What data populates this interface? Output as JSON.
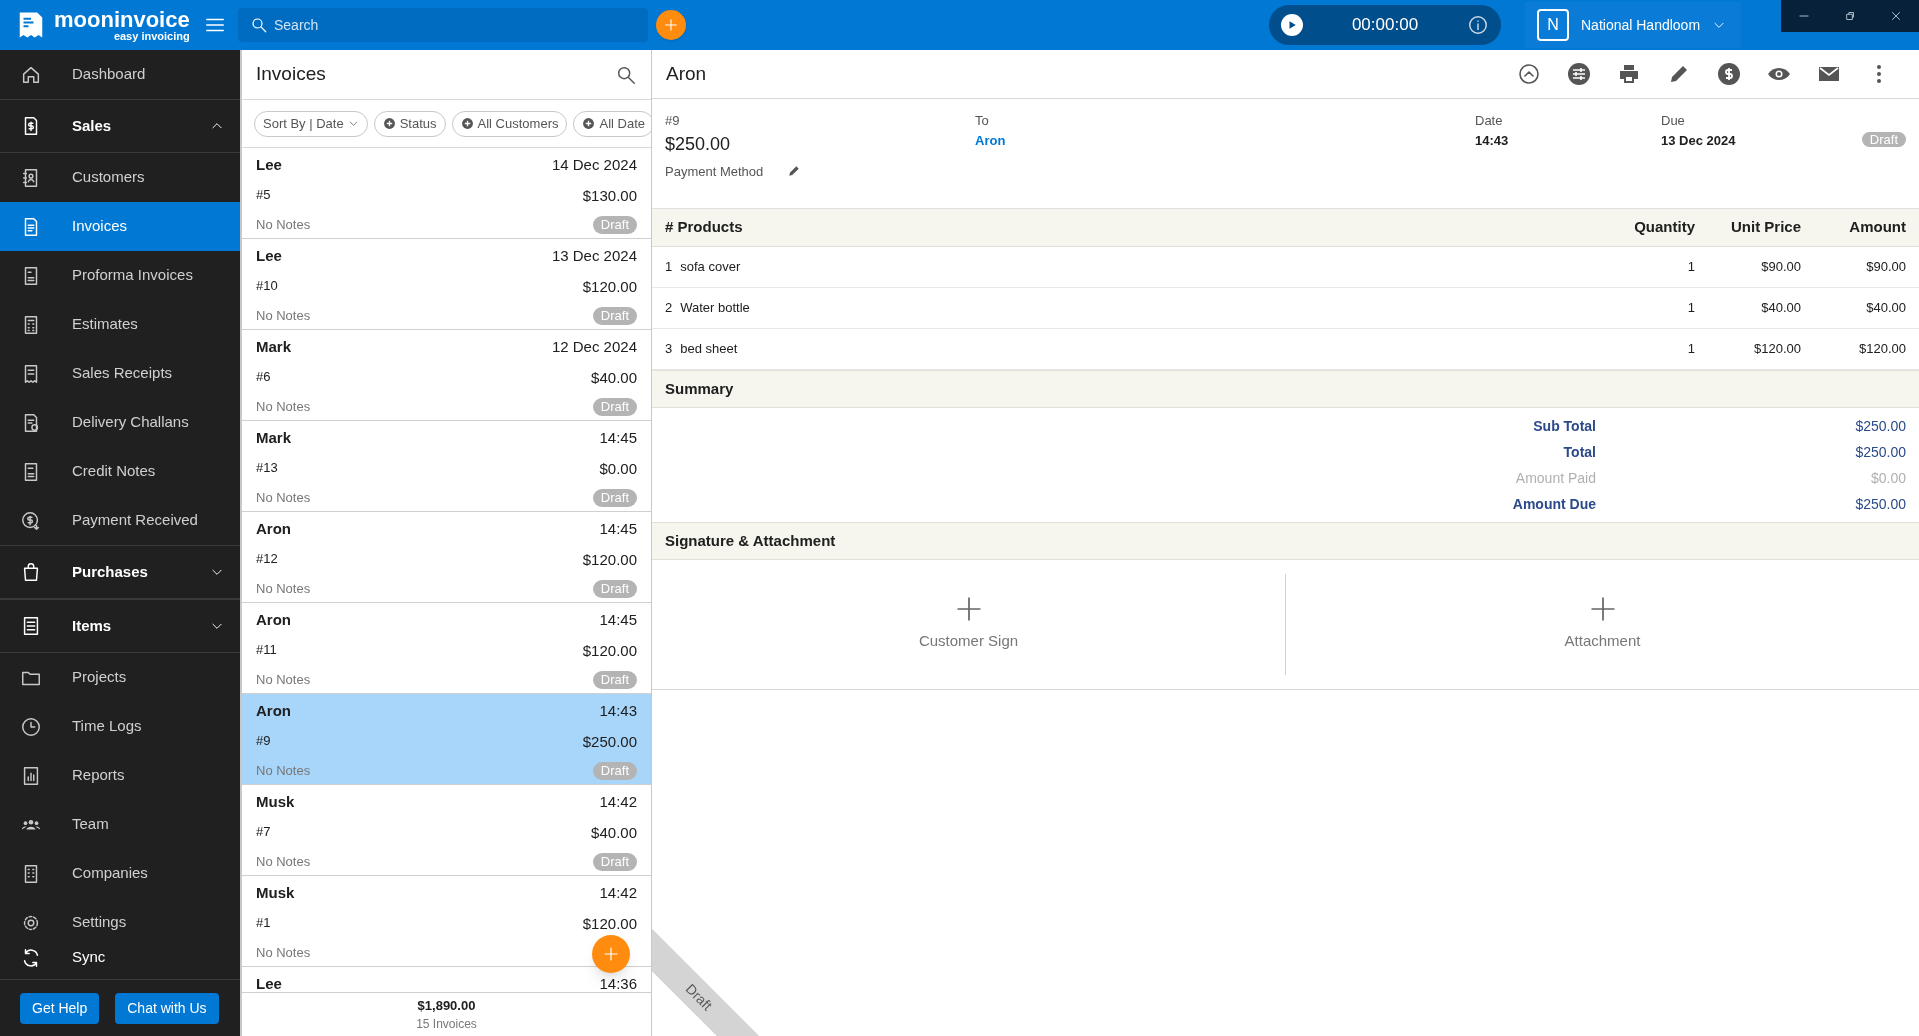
{
  "topbar": {
    "logo": "mooninvoice",
    "tagline": "easy invoicing",
    "search": {
      "placeholder": "Search"
    },
    "timer": "00:00:00",
    "company_initial": "N",
    "company": "National Handloom"
  },
  "sidebar": {
    "items": [
      {
        "kind": "item",
        "label": "Dashboard",
        "selected": false
      },
      {
        "kind": "section",
        "label": "Sales",
        "expanded": true
      },
      {
        "kind": "item",
        "label": "Customers",
        "selected": false
      },
      {
        "kind": "item",
        "label": "Invoices",
        "selected": true
      },
      {
        "kind": "item",
        "label": "Proforma Invoices",
        "selected": false
      },
      {
        "kind": "item",
        "label": "Estimates",
        "selected": false
      },
      {
        "kind": "item",
        "label": "Sales Receipts",
        "selected": false
      },
      {
        "kind": "item",
        "label": "Delivery Challans",
        "selected": false
      },
      {
        "kind": "item",
        "label": "Credit Notes",
        "selected": false
      },
      {
        "kind": "item",
        "label": "Payment Received",
        "selected": false
      },
      {
        "kind": "section",
        "label": "Purchases",
        "expanded": false
      },
      {
        "kind": "section",
        "label": "Items",
        "expanded": false
      },
      {
        "kind": "item",
        "label": "Projects",
        "selected": false
      },
      {
        "kind": "item",
        "label": "Time Logs",
        "selected": false
      },
      {
        "kind": "item",
        "label": "Reports",
        "selected": false
      },
      {
        "kind": "item",
        "label": "Team",
        "selected": false
      },
      {
        "kind": "item",
        "label": "Companies",
        "selected": false
      },
      {
        "kind": "item",
        "label": "Settings",
        "selected": false
      }
    ],
    "sync": "Sync",
    "buttons": [
      "Get Help",
      "Chat with Us"
    ]
  },
  "list": {
    "title": "Invoices",
    "filters": [
      "Sort By | Date",
      "Status",
      "All Customers",
      "All Date"
    ],
    "invoices": [
      {
        "customer": "Lee",
        "date": "14 Dec 2024",
        "number": "#5",
        "amount": "$130.00",
        "notes": "No Notes",
        "status": "Draft",
        "selected": false
      },
      {
        "customer": "Lee",
        "date": "13 Dec 2024",
        "number": "#10",
        "amount": "$120.00",
        "notes": "No Notes",
        "status": "Draft",
        "selected": false
      },
      {
        "customer": "Mark",
        "date": "12 Dec 2024",
        "number": "#6",
        "amount": "$40.00",
        "notes": "No Notes",
        "status": "Draft",
        "selected": false
      },
      {
        "customer": "Mark",
        "date": "14:45",
        "number": "#13",
        "amount": "$0.00",
        "notes": "No Notes",
        "status": "Draft",
        "selected": false
      },
      {
        "customer": "Aron",
        "date": "14:45",
        "number": "#12",
        "amount": "$120.00",
        "notes": "No Notes",
        "status": "Draft",
        "selected": false
      },
      {
        "customer": "Aron",
        "date": "14:45",
        "number": "#11",
        "amount": "$120.00",
        "notes": "No Notes",
        "status": "Draft",
        "selected": false
      },
      {
        "customer": "Aron",
        "date": "14:43",
        "number": "#9",
        "amount": "$250.00",
        "notes": "No Notes",
        "status": "Draft",
        "selected": true
      },
      {
        "customer": "Musk",
        "date": "14:42",
        "number": "#7",
        "amount": "$40.00",
        "notes": "No Notes",
        "status": "Draft",
        "selected": false
      },
      {
        "customer": "Musk",
        "date": "14:42",
        "number": "#1",
        "amount": "$120.00",
        "notes": "No Notes",
        "selected": false
      },
      {
        "customer": "Lee",
        "date": "14:36",
        "selected": false
      }
    ],
    "total": "$1,890.00",
    "count": "15 Invoices"
  },
  "detail": {
    "title": "Aron",
    "number": "#9",
    "amount": "$250.00",
    "payment_method": "Payment Method",
    "to_label": "To",
    "to": "Aron",
    "date_label": "Date",
    "date": "14:43",
    "due_label": "Due",
    "due": "13 Dec 2024",
    "status": "Draft",
    "products": {
      "columns": [
        "# Products",
        "Quantity",
        "Unit Price",
        "Amount"
      ],
      "rows": [
        {
          "index": "1",
          "name": "sofa cover",
          "quantity": "1",
          "unit_price": "$90.00",
          "amount": "$90.00"
        },
        {
          "index": "2",
          "name": "Water bottle",
          "quantity": "1",
          "unit_price": "$40.00",
          "amount": "$40.00"
        },
        {
          "index": "3",
          "name": "bed sheet",
          "quantity": "1",
          "unit_price": "$120.00",
          "amount": "$120.00"
        }
      ]
    },
    "summary": {
      "title": "Summary",
      "rows": [
        {
          "label": "Sub Total",
          "value": "$250.00",
          "muted": false
        },
        {
          "label": "Total",
          "value": "$250.00",
          "muted": false
        },
        {
          "label": "Amount Paid",
          "value": "$0.00",
          "muted": true
        },
        {
          "label": "Amount Due",
          "value": "$250.00",
          "muted": false
        }
      ]
    },
    "signature": {
      "title": "Signature & Attachment",
      "slots": [
        "Customer Sign",
        "Attachment"
      ]
    },
    "ribbon": "Draft"
  }
}
